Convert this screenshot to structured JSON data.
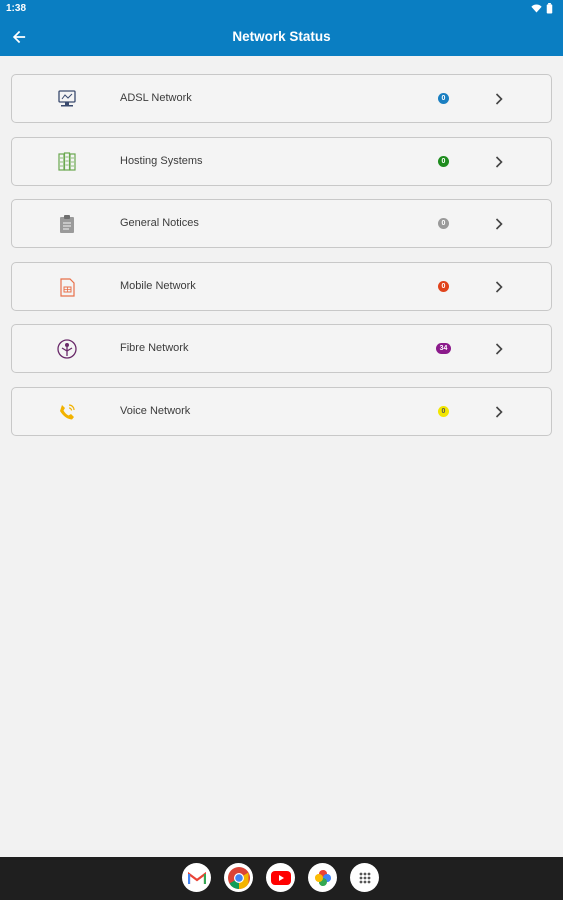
{
  "status_bar": {
    "time": "1:38"
  },
  "app_bar": {
    "title": "Network Status"
  },
  "colors": {
    "primary": "#0a7ec2",
    "adsl_badge": "#1a7fc1",
    "hosting_badge": "#1e8c1e",
    "notices_badge": "#9a9a9a",
    "mobile_badge": "#e0441c",
    "fibre_badge": "#8b1a8b",
    "voice_badge": "#f2e600"
  },
  "items": [
    {
      "label": "ADSL Network",
      "count": "0",
      "icon": "monitor-network-icon"
    },
    {
      "label": "Hosting Systems",
      "count": "0",
      "icon": "server-rack-icon"
    },
    {
      "label": "General Notices",
      "count": "0",
      "icon": "clipboard-icon"
    },
    {
      "label": "Mobile Network",
      "count": "0",
      "icon": "sim-card-icon"
    },
    {
      "label": "Fibre Network",
      "count": "34",
      "icon": "fibre-tree-icon"
    },
    {
      "label": "Voice Network",
      "count": "0",
      "icon": "phone-ringing-icon"
    }
  ],
  "dock": [
    "gmail-icon",
    "chrome-icon",
    "youtube-icon",
    "photos-icon",
    "app-drawer-icon"
  ]
}
